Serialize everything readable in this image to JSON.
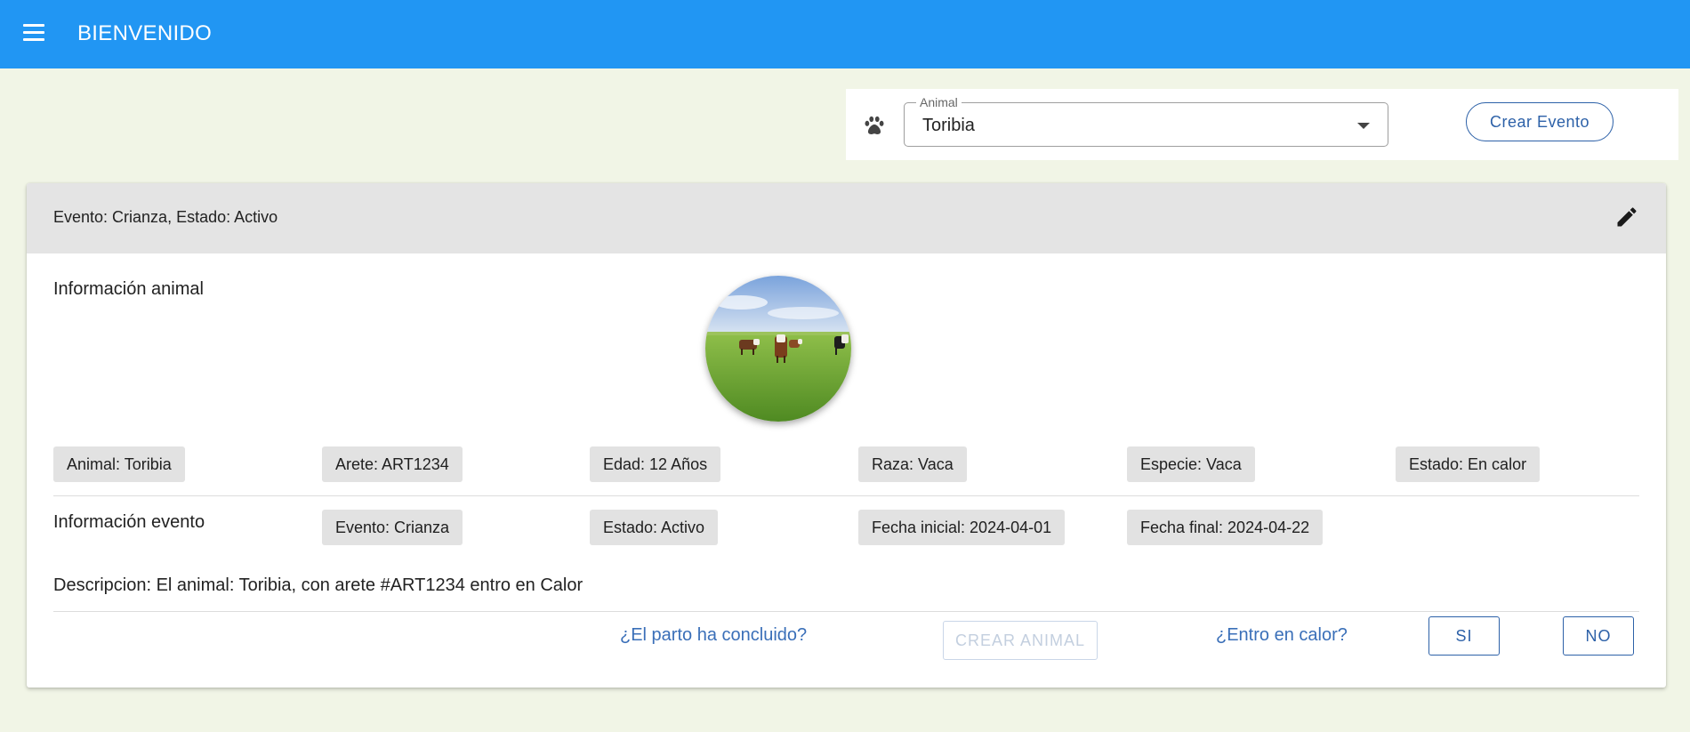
{
  "header": {
    "title": "BIENVENIDO"
  },
  "animal_select": {
    "legend": "Animal",
    "value": "Toribia"
  },
  "toolbar": {
    "crear_evento": "Crear Evento"
  },
  "card": {
    "header_title": "Evento: Crianza, Estado: Activo",
    "animal_section_label": "Información animal",
    "animal_chips": [
      "Animal: Toribia",
      "Arete: ART1234",
      "Edad: 12 Años",
      "Raza: Vaca",
      "Especie: Vaca",
      "Estado: En calor"
    ],
    "evento_section_label": "Información evento",
    "evento_chips": [
      "Evento: Crianza",
      "Estado: Activo",
      "Fecha inicial: 2024-04-01",
      "Fecha final: 2024-04-22"
    ],
    "description": "Descripcion: El animal: Toribia, con arete #ART1234 entro en Calor",
    "parto_question": "¿El parto ha concluido?",
    "crear_animal": "CREAR ANIMAL",
    "calor_question": "¿Entro en calor?",
    "si": "SI",
    "no": "NO"
  }
}
